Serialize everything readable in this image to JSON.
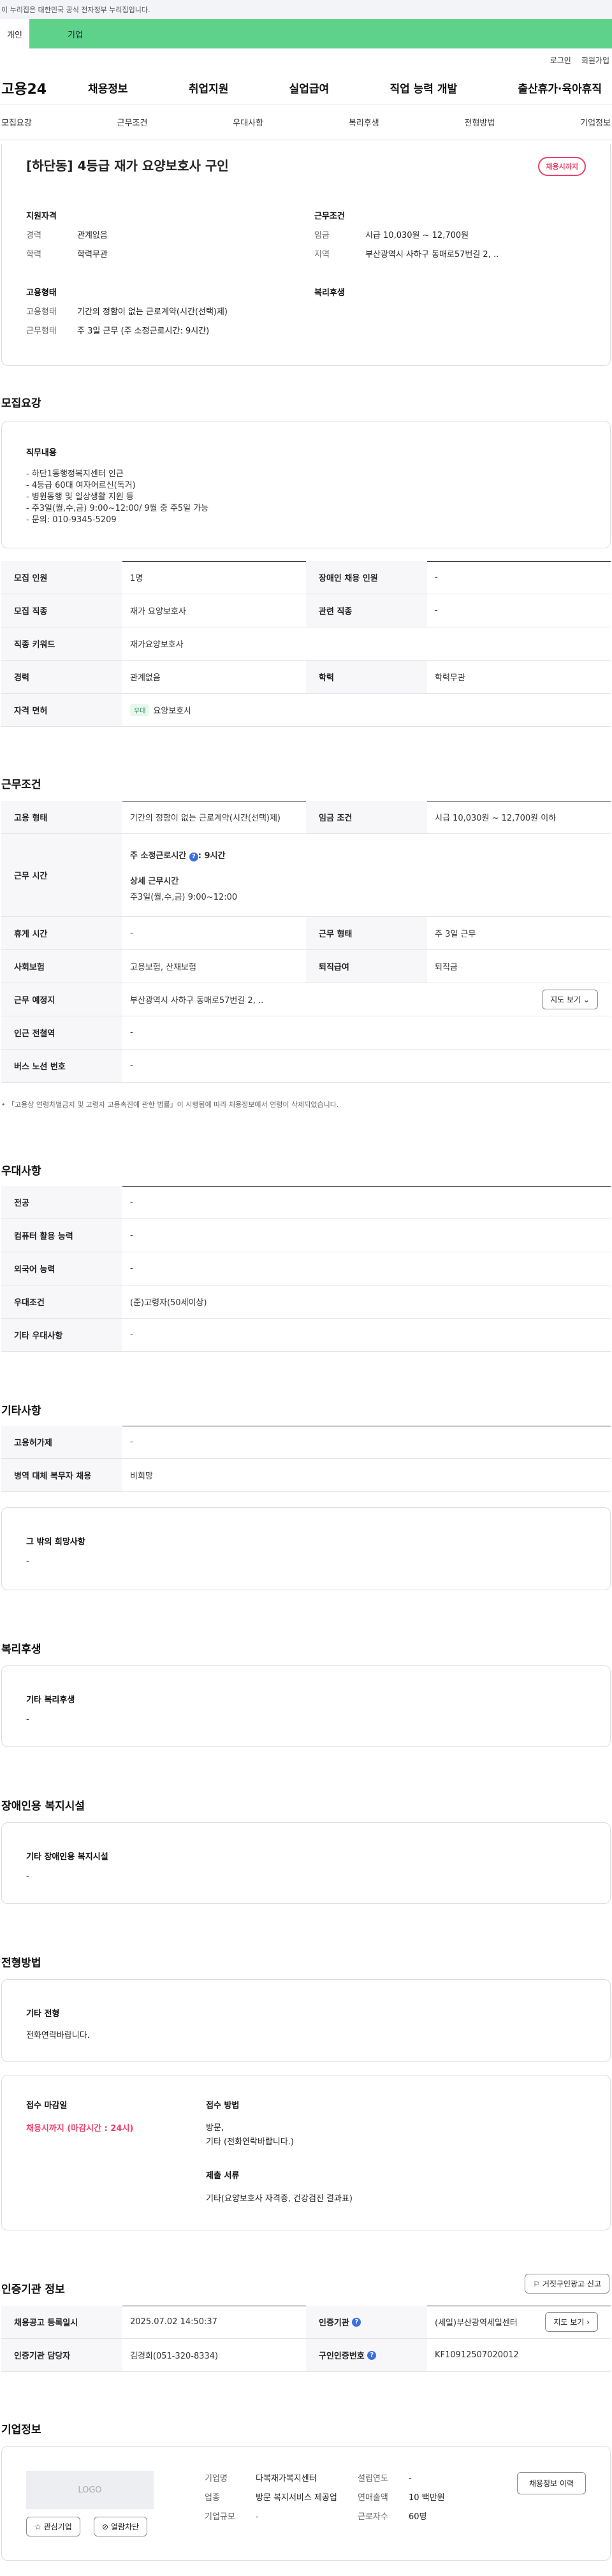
{
  "top": {
    "gov": "이 누리집은 대한민국 공식 전자정부 누리집입니다.",
    "tab_person": "개인",
    "tab_company": "기업",
    "login": "로그인",
    "join": "회원가입",
    "logo": "고용24",
    "menu": [
      "채용정보",
      "취업지원",
      "실업급여",
      "직업 능력 개발",
      "출산휴가·육아휴직"
    ],
    "anchors": [
      "모집요강",
      "근무조건",
      "우대사항",
      "복리후생",
      "전형방법",
      "기업정보"
    ]
  },
  "job": {
    "title": "[하단동] 4등급 재가 요양보호사 구인",
    "badge": "채용시까지",
    "qual_h": "지원자격",
    "career_k": "경력",
    "career_v": "관계없음",
    "edu_k": "학력",
    "edu_v": "학력무관",
    "cond_h": "근무조건",
    "wage_k": "임금",
    "wage_v": "시급 10,030원 ~ 12,700원",
    "area_k": "지역",
    "area_v": "부산광역시 사하구 동매로57번길 2, ..",
    "type_h": "고용형태",
    "emp_k": "고용형태",
    "emp_v": "기간의 정함이 없는 근로계약(시간(선택)제)",
    "work_k": "근무형태",
    "work_v": "주 3일 근무 (주 소정근로시간: 9시간)",
    "welfare_h": "복리후생"
  },
  "recruit": {
    "h": "모집요강",
    "duty_h": "직무내용",
    "duty": [
      "- 하단1동행정복지센터 인근",
      "- 4등급 60대 여자어르신(독거)",
      "- 병원동행 및 일상생활 지원 등",
      "- 주3일(월,수,금) 9:00~12:00/ 9월 중 주5일 가능",
      "- 문의: 010-9345-5209"
    ],
    "rows": [
      [
        "모집 인원",
        "1명",
        "장애인 채용 인원",
        "-"
      ],
      [
        "모집 직종",
        "재가 요양보호사",
        "관련 직종",
        "-"
      ]
    ],
    "kw_k": "직종 키워드",
    "kw_v": "재가요양보호사",
    "career_k": "경력",
    "career_v": "관계없음",
    "edu_k": "학력",
    "edu_v": "학력무관",
    "lic_k": "자격 면허",
    "lic_chip": "우대",
    "lic_v": "요양보호사"
  },
  "cond": {
    "h": "근무조건",
    "emp_k": "고용 형태",
    "emp_v": "기간의 정함이 없는 근로계약(시간(선택)제)",
    "wage_k": "임금 조건",
    "wage_v": "시급 10,030원 ~ 12,700원 이하",
    "time_k": "근무 시간",
    "time1": "주 소정근로시간",
    "time1v": ": 9시간",
    "time2": "상세 근무시간",
    "time2v": "주3일(월,수,금) 9:00~12:00",
    "rest_k": "휴게 시간",
    "rest_v": "-",
    "form_k": "근무 형태",
    "form_v": "주 3일 근무",
    "ins_k": "사회보험",
    "ins_v": "고용보험, 산재보험",
    "ret_k": "퇴직급여",
    "ret_v": "퇴직금",
    "place_k": "근무 예정지",
    "place_v": "부산광역시 사하구 동매로57번길 2, ..",
    "map": "지도 보기",
    "sub_k": "인근 전철역",
    "sub_v": "-",
    "bus_k": "버스 노선 번호",
    "bus_v": "-",
    "note": "「고용상 연령차별금지 및 고령자 고용촉진에 관한 법률」이 시행됨에 따라 채용정보에서 연령이 삭제되었습니다."
  },
  "pref": {
    "h": "우대사항",
    "rows": [
      [
        "전공",
        "-"
      ],
      [
        "컴퓨터 활용 능력",
        "-"
      ],
      [
        "외국어 능력",
        "-"
      ],
      [
        "우대조건",
        "(준)고령자(50세이상)"
      ],
      [
        "기타 우대사항",
        "-"
      ]
    ]
  },
  "etc": {
    "h": "기타사항",
    "rows": [
      [
        "고용허가제",
        "-"
      ],
      [
        "병역 대체 복무자 채용",
        "비희망"
      ]
    ],
    "hope_h": "그 밖의 희망사항",
    "hope_v": "-"
  },
  "welfare": {
    "h": "복리후생",
    "sub": "기타 복리후생",
    "v": "-"
  },
  "disabled": {
    "h": "장애인용 복지시설",
    "sub": "기타 장애인용 복지시설",
    "v": "-"
  },
  "select": {
    "h": "전형방법",
    "sub": "기타 전형",
    "v": "전화연락바랍니다.",
    "deadline_h": "접수 마감일",
    "deadline_v": "채용시까지 (마감시간 : 24시)",
    "method_h": "접수 방법",
    "method_v1": "방문,",
    "method_v2": "기타 (전화연락바랍니다.)",
    "doc_h": "제출 서류",
    "doc_v": "기타(요양보호사 자격증, 건강검진 결과표)"
  },
  "agency": {
    "h": "인증기관 정보",
    "report": "거짓구인광고 신고",
    "reg_k": "채용공고 등록일시",
    "reg_v": "2025.07.02 14:50:37",
    "org_k": "인증기관",
    "org_v": "(세일)부산광역세일센터",
    "map": "지도 보기",
    "mgr_k": "인증기관 담당자",
    "mgr_v": "김경희(051-320-8334)",
    "no_k": "구인인증번호",
    "no_v": "KF10912507020012"
  },
  "company": {
    "h": "기업정보",
    "logo": "LOGO",
    "fav": "관심기업",
    "block": "열람차단",
    "name_k": "기업명",
    "name_v": "다복재가복지센터",
    "year_k": "설립연도",
    "year_v": "-",
    "ind_k": "업종",
    "ind_v": "방문 복지서비스 제공업",
    "sales_k": "연매출액",
    "sales_v": "10 백만원",
    "emp_k": "근로자수",
    "emp_v": "60명",
    "size_k": "기업규모",
    "size_v": "-",
    "hist": "채용정보 이력"
  }
}
